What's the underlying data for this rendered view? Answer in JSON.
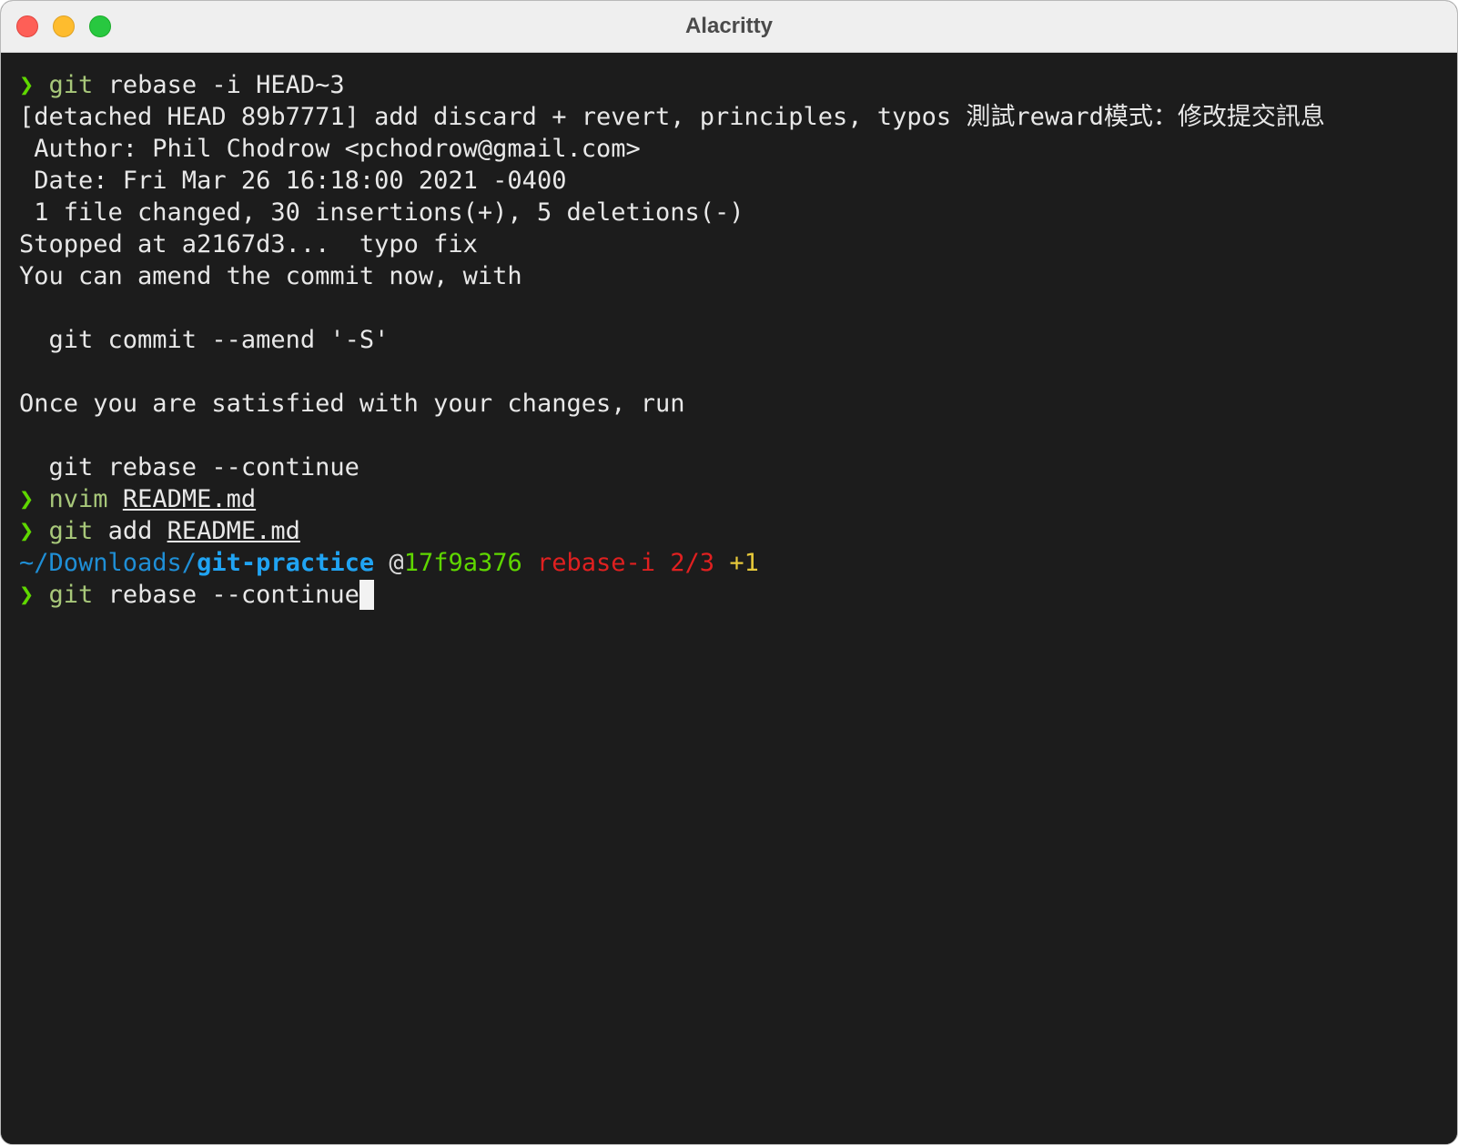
{
  "window": {
    "title": "Alacritty",
    "buttons": {
      "close": "close",
      "minimize": "minimize",
      "zoom": "zoom"
    }
  },
  "colors": {
    "background": "#1c1c1c",
    "prompt": "#5fd700",
    "command": "#a8c87a",
    "path": "#20a4f3",
    "commit_hash": "#5fd700",
    "rebase_state": "#e02020",
    "change_count": "#e6c83a"
  },
  "terminal": {
    "prompt_symbol": "❯",
    "cmd1": {
      "program": "git",
      "args": " rebase -i HEAD~3"
    },
    "output": {
      "detached": "[detached HEAD 89b7771] add discard + revert, principles, typos 測試reward模式：修改提交訊息",
      "author": " Author: Phil Chodrow <pchodrow@gmail.com>",
      "date": " Date: Fri Mar 26 16:18:00 2021 -0400",
      "stats": " 1 file changed, 30 insertions(+), 5 deletions(-)",
      "stopped": "Stopped at a2167d3...  typo fix",
      "amend_hint": "You can amend the commit now, with",
      "amend_cmd": "  git commit --amend '-S'",
      "satisfied": "Once you are satisfied with your changes, run",
      "continue_cmd": "  git rebase --continue"
    },
    "cmd2": {
      "program": "nvim",
      "file": "README.md"
    },
    "cmd3": {
      "program": "git",
      "args": " add ",
      "file": "README.md"
    },
    "status": {
      "path_prefix": "~/Downloads/",
      "path_dir": "git-practice",
      "at": "@",
      "commit": "17f9a376",
      "rebase": "rebase-i 2/3",
      "changes": "+1"
    },
    "cmd4": {
      "program": "git",
      "args": " rebase --continue"
    }
  }
}
